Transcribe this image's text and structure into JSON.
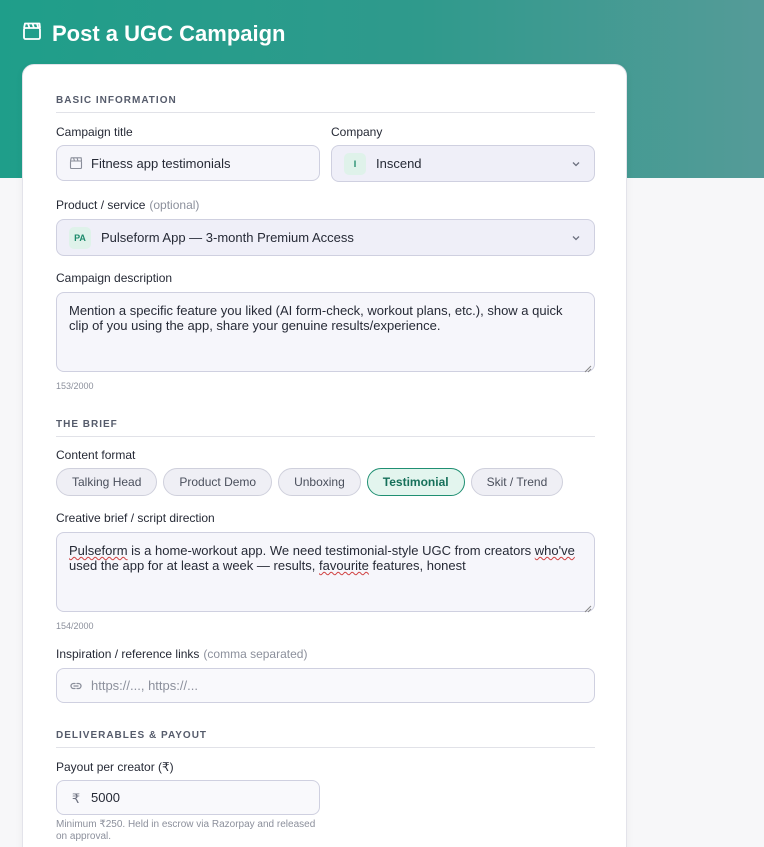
{
  "header": {
    "title": "Post a UGC Campaign",
    "icon": "clapperboard-icon"
  },
  "sections": {
    "basic": "BASIC INFORMATION",
    "brief": "THE BRIEF",
    "deliverables": "DELIVERABLES & PAYOUT"
  },
  "campaign_title": {
    "label": "Campaign title",
    "value": "Fitness app testimonials"
  },
  "company": {
    "label": "Company",
    "badge": "I",
    "value": "Inscend"
  },
  "product": {
    "label": "Product / service",
    "optional": "(optional)",
    "badge": "PA",
    "value": "Pulseform App — 3-month Premium Access"
  },
  "description": {
    "label": "Campaign description",
    "value": "Mention a specific feature you liked (AI form-check, workout plans, etc.), show a quick clip of you using the app, share your genuine results/experience.",
    "counter": "153/2000"
  },
  "content_format": {
    "label": "Content format",
    "options": [
      "Talking Head",
      "Product Demo",
      "Unboxing",
      "Testimonial",
      "Skit / Trend"
    ],
    "selected": "Testimonial"
  },
  "brief": {
    "label": "Creative brief / script direction",
    "word1": "Pulseform",
    "part1": " is a home-workout app. We need testimonial-style UGC from creators ",
    "word2": "who've",
    "part2": " used the app for at least a week — results, ",
    "word3": "favourite",
    "part3": " features, honest",
    "counter": "154/2000"
  },
  "inspiration": {
    "label": "Inspiration / reference links",
    "hint": "(comma separated)",
    "placeholder": "https://..., https://..."
  },
  "payout": {
    "label": "Payout per creator (₹)",
    "currency": "₹",
    "value": "5000",
    "help": "Minimum ₹250. Held in escrow via Razorpay and released on approval."
  },
  "colors": {
    "accent": "#1f9e8a",
    "chip_active": "#1f8f72"
  }
}
